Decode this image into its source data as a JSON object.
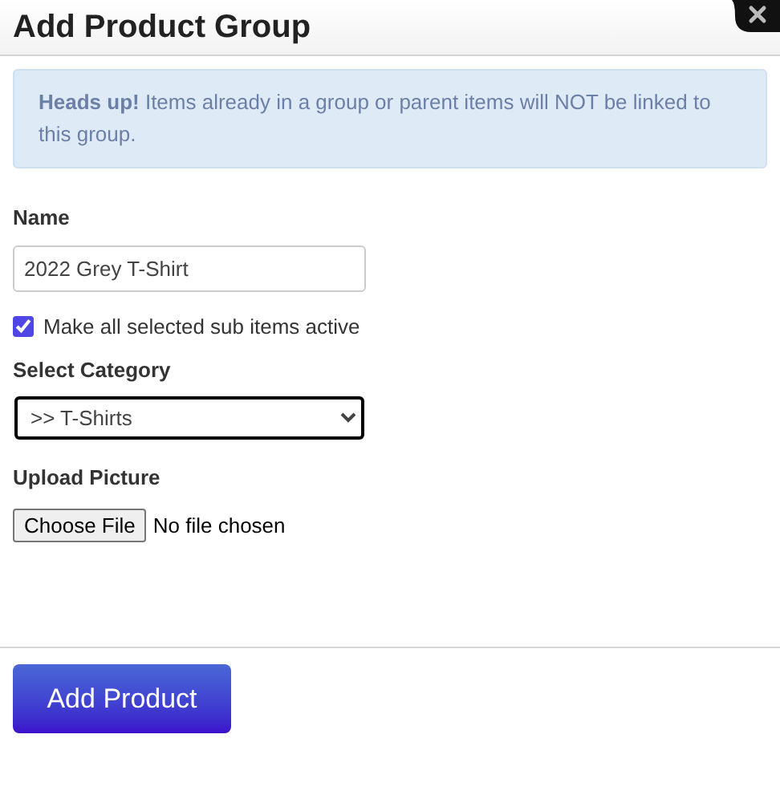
{
  "window": {
    "title": "Add Product Group"
  },
  "alert": {
    "text": "**Heads up!** Items already in a group or parent items will NOT be linked to this group."
  },
  "form": {
    "name_label": "Name",
    "name_value": "2022 Grey T-Shirt",
    "checkbox": {
      "label": "Make all selected sub items active",
      "checked": true
    },
    "category_label": "Select Category",
    "category_value": ">> T-Shirts",
    "upload_label": "Upload Picture",
    "file_button": "Choose File",
    "file_status": "No file chosen"
  },
  "submit_button": "Add Product"
}
